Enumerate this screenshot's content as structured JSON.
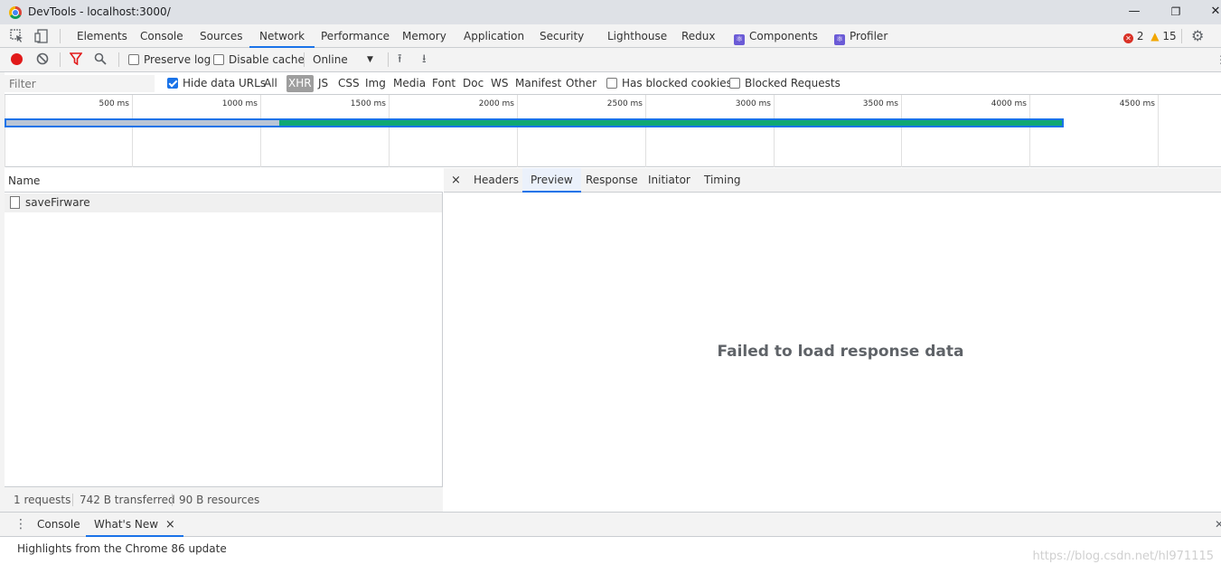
{
  "window": {
    "title": "DevTools - localhost:3000/"
  },
  "main_tabs": [
    "Elements",
    "Console",
    "Sources",
    "Network",
    "Performance",
    "Memory",
    "Application",
    "Security",
    "Lighthouse",
    "Redux",
    "Components",
    "Profiler"
  ],
  "active_main_tab": "Network",
  "status": {
    "errors": "2",
    "warnings": "15"
  },
  "toolbar": {
    "preserve_log": "Preserve log",
    "disable_cache": "Disable cache",
    "throttle": "Online"
  },
  "filterbar": {
    "filter_placeholder": "Filter",
    "hide_data_urls": "Hide data URLs",
    "types": [
      "All",
      "XHR",
      "JS",
      "CSS",
      "Img",
      "Media",
      "Font",
      "Doc",
      "WS",
      "Manifest",
      "Other"
    ],
    "selected_type": "XHR",
    "has_blocked_cookies": "Has blocked cookies",
    "blocked_requests": "Blocked Requests"
  },
  "overview": {
    "ticks": [
      "500 ms",
      "1000 ms",
      "1500 ms",
      "2000 ms",
      "2500 ms",
      "3000 ms",
      "3500 ms",
      "4000 ms",
      "4500 ms"
    ]
  },
  "requests": {
    "column_name": "Name",
    "rows": [
      {
        "name": "saveFirware"
      }
    ],
    "footer": {
      "count": "1 requests",
      "transferred": "742 B transferred",
      "resources": "90 B resources"
    }
  },
  "detail": {
    "close": "×",
    "tabs": [
      "Headers",
      "Preview",
      "Response",
      "Initiator",
      "Timing"
    ],
    "active_tab": "Preview",
    "message": "Failed to load response data"
  },
  "drawer": {
    "tabs": [
      "Console",
      "What's New"
    ],
    "active_tab": "What's New",
    "close": "×",
    "content": "Highlights from the Chrome 86 update"
  },
  "watermark": "https://blog.csdn.net/hl971115",
  "colors": {
    "accent": "#1a73e8",
    "record": "#e11919",
    "bar_receive": "#0fa873"
  }
}
